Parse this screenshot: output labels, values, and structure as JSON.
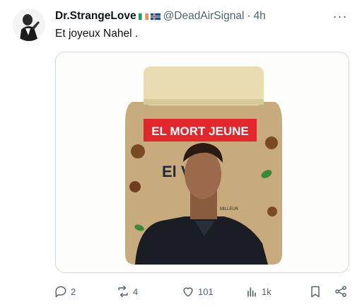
{
  "tweet": {
    "author_name": "Dr.StrangeLove",
    "handle": "@DeadAirSignal",
    "separator": "·",
    "time": "4h",
    "text": "Et joyeux Nahel .",
    "more_label": "···"
  },
  "media": {
    "caption_text": "EL MORT JEUNE",
    "label_big_text": "El V",
    "label_small_text": "MILLEUR",
    "colors": {
      "jar_lid": "#e8dcb0",
      "jar_body": "#c8ab7d",
      "caption_bg": "#e3262b",
      "caption_text": "#ffffff"
    }
  },
  "actions": {
    "replies": "2",
    "reposts": "4",
    "likes": "101",
    "views": "1k"
  },
  "icons": [
    "avatar",
    "flag-icon",
    "reply-icon",
    "repost-icon",
    "like-icon",
    "views-icon",
    "bookmark-icon",
    "share-icon",
    "more-icon"
  ]
}
